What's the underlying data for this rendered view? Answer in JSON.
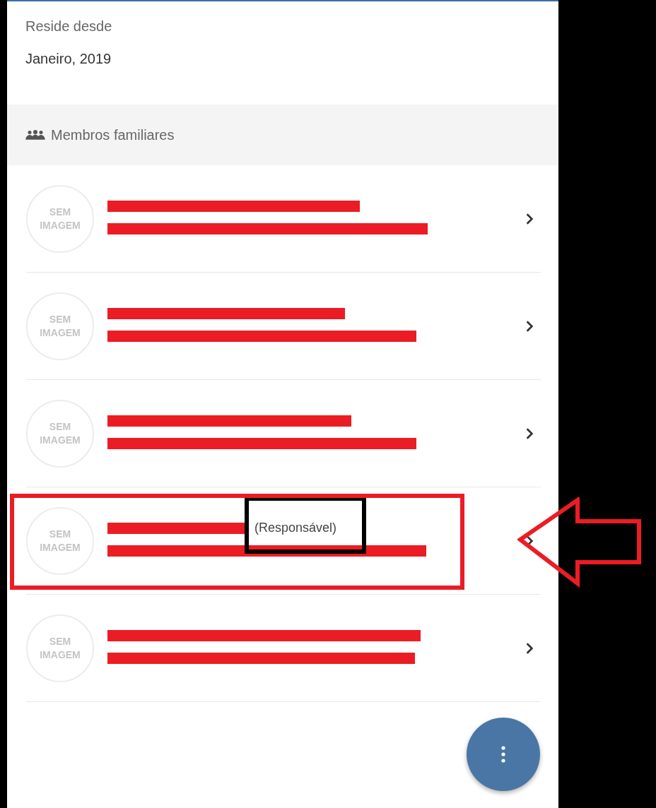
{
  "residence": {
    "label": "Reside desde",
    "value": "Janeiro, 2019"
  },
  "section": {
    "title": "Membros familiares"
  },
  "members": [
    {
      "avatar_text": "SEM IMAGEM",
      "highlighted": false
    },
    {
      "avatar_text": "SEM IMAGEM",
      "highlighted": false
    },
    {
      "avatar_text": "SEM IMAGEM",
      "highlighted": false
    },
    {
      "avatar_text": "SEM IMAGEM",
      "tag": "(Responsável)",
      "highlighted": true
    },
    {
      "avatar_text": "SEM IMAGEM",
      "highlighted": false
    }
  ]
}
